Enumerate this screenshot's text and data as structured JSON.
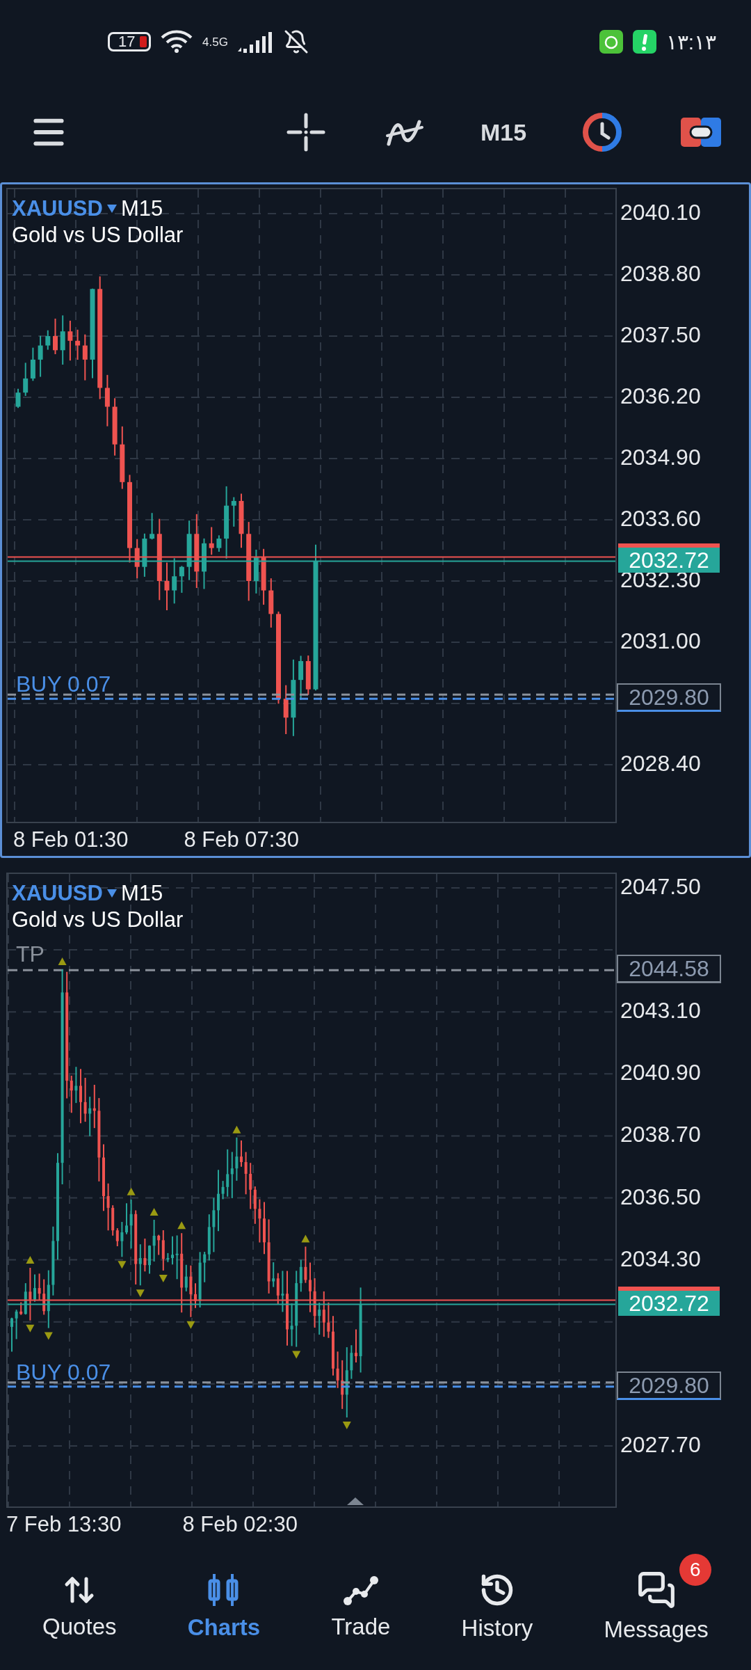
{
  "status_bar": {
    "battery": "17",
    "network": "4.5G",
    "time": "۱۳:۱۳"
  },
  "toolbar": {
    "timeframe": "M15"
  },
  "charts": [
    {
      "selected": true,
      "symbol": "XAUUSD",
      "timeframe": "M15",
      "description": "Gold vs US Dollar",
      "price_labels": [
        "2040.10",
        "2038.80",
        "2037.50",
        "2036.20",
        "2034.90",
        "2033.60",
        "2032.30",
        "2031.00",
        "2028.40"
      ],
      "current_price": "2032.72",
      "order": {
        "label": "BUY 0.07",
        "price": "2029.80"
      },
      "time_labels": [
        "8 Feb 01:30",
        "8 Feb 07:30"
      ]
    },
    {
      "selected": false,
      "symbol": "XAUUSD",
      "timeframe": "M15",
      "description": "Gold vs US Dollar",
      "price_labels": [
        "2047.50",
        "2043.10",
        "2040.90",
        "2038.70",
        "2036.50",
        "2034.30",
        "2027.70"
      ],
      "current_price": "2032.72",
      "take_profit": {
        "label": "TP",
        "price": "2044.58"
      },
      "order": {
        "label": "BUY 0.07",
        "price": "2029.80"
      },
      "time_labels": [
        "7 Feb 13:30",
        "8 Feb 02:30"
      ]
    }
  ],
  "nav": [
    {
      "label": "Quotes",
      "selected": false
    },
    {
      "label": "Charts",
      "selected": true
    },
    {
      "label": "Trade",
      "selected": false
    },
    {
      "label": "History",
      "selected": false
    },
    {
      "label": "Messages",
      "selected": false,
      "badge": "6"
    }
  ]
}
